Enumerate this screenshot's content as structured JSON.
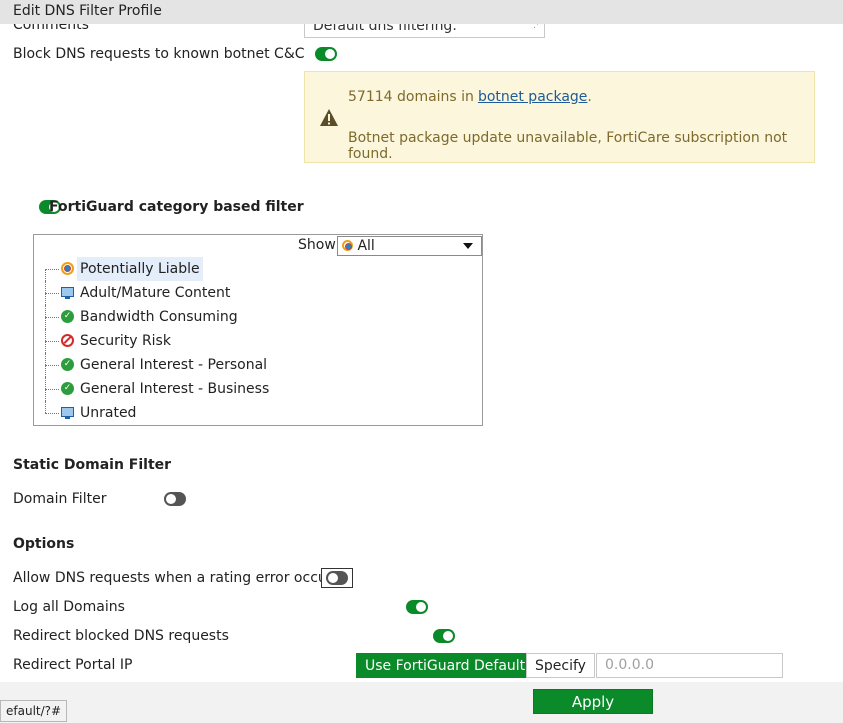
{
  "window": {
    "title": "Edit DNS Filter Profile"
  },
  "comments": {
    "label": "Comments",
    "value": "Default dns filtering."
  },
  "botnet": {
    "label": "Block DNS requests to known botnet C&C",
    "enabled": true,
    "info_prefix": "57114 domains in",
    "link_text": "botnet package",
    "info_suffix": ".",
    "warning": "Botnet package update unavailable, FortiCare subscription not found."
  },
  "fortiguard": {
    "label": "FortiGuard category based filter",
    "enabled": true,
    "show_label": "Show",
    "show_value": "All",
    "categories": [
      {
        "label": "Potentially Liable",
        "icon": "potentially-liable-icon"
      },
      {
        "label": "Adult/Mature Content",
        "icon": "monitor-icon"
      },
      {
        "label": "Bandwidth Consuming",
        "icon": "allow-check-icon"
      },
      {
        "label": "Security Risk",
        "icon": "block-icon"
      },
      {
        "label": "General Interest - Personal",
        "icon": "allow-check-icon"
      },
      {
        "label": "General Interest - Business",
        "icon": "allow-check-icon"
      },
      {
        "label": "Unrated",
        "icon": "monitor-icon"
      }
    ]
  },
  "static_domain": {
    "heading": "Static Domain Filter",
    "domain_filter_label": "Domain Filter",
    "domain_filter_enabled": false
  },
  "options": {
    "heading": "Options",
    "rating_error_label": "Allow DNS requests when a rating error occurs",
    "rating_error_enabled": false,
    "log_all_label": "Log all Domains",
    "log_all_enabled": true,
    "redirect_label": "Redirect blocked DNS requests",
    "redirect_enabled": true,
    "portal_ip_label": "Redirect Portal IP",
    "portal_default_label": "Use FortiGuard Default",
    "portal_specify_label": "Specify",
    "portal_ip_placeholder": "0.0.0.0"
  },
  "footer": {
    "apply_label": "Apply",
    "status_url": "efault/?#"
  },
  "colors": {
    "accent": "#0b8a2a",
    "warning_bg": "#fcf6dc",
    "link": "#1d5c96"
  }
}
